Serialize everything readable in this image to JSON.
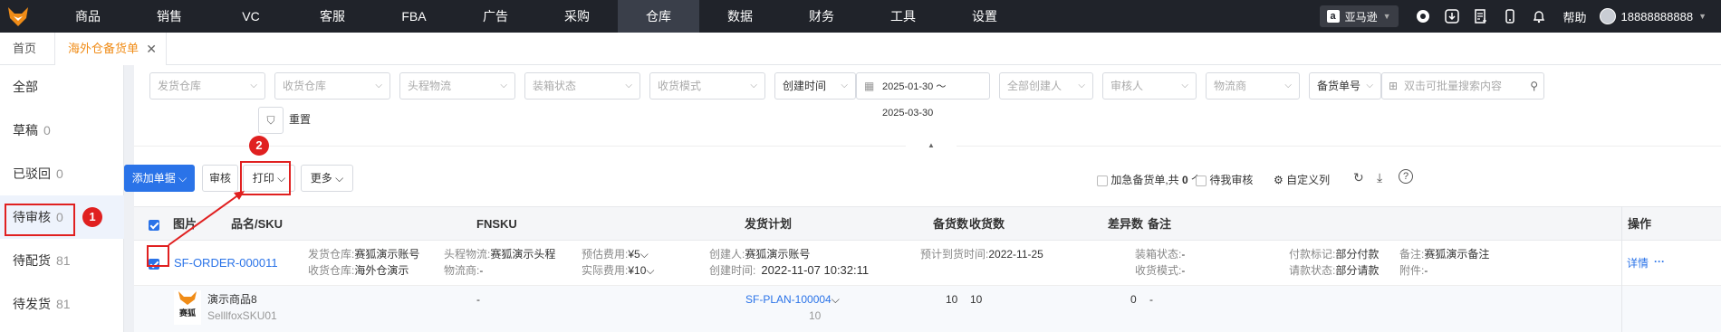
{
  "nav": {
    "items": [
      "商品",
      "销售",
      "VC",
      "客服",
      "FBA",
      "广告",
      "采购",
      "仓库",
      "数据",
      "财务",
      "工具",
      "设置"
    ],
    "active": "仓库",
    "store": "亚马逊",
    "help": "帮助",
    "user": "18888888888"
  },
  "tabs": {
    "home": "首页",
    "current": "海外仓备货单"
  },
  "sidebar": {
    "items": [
      {
        "label": "全部",
        "count": ""
      },
      {
        "label": "草稿",
        "count": "0"
      },
      {
        "label": "已驳回",
        "count": "0"
      },
      {
        "label": "待审核",
        "count": "0"
      },
      {
        "label": "待配货",
        "count": "81"
      },
      {
        "label": "待发货",
        "count": "81"
      }
    ]
  },
  "filters": {
    "ship_warehouse": "发货仓库",
    "recv_warehouse": "收货仓库",
    "first_leg": "头程物流",
    "packing_status": "装箱状态",
    "recv_mode": "收货模式",
    "time_type": "创建时间",
    "date_range": "2025-01-30 ～ 2025-03-30",
    "creator": "全部创建人",
    "reviewer": "审核人",
    "logistics": "物流商",
    "order_no_type": "备货单号",
    "search_placeholder": "双击可批量搜索内容",
    "reset": "重置"
  },
  "toolbar": {
    "add": "添加单据",
    "review": "审核",
    "print": "打印",
    "more": "更多",
    "urgent": "加急备货单,共",
    "urgent_count": "0",
    "urgent_unit": "个",
    "my_review": "待我审核",
    "custom_cols": "自定义列"
  },
  "table": {
    "headers": {
      "image": "图片",
      "name_sku": "品名/SKU",
      "fnsku": "FNSKU",
      "plan": "发货计划",
      "stock_qty": "备货数",
      "recv_qty": "收货数",
      "diff_qty": "差异数",
      "remark": "备注",
      "op": "操作"
    },
    "order": {
      "id": "SF-ORDER-000011",
      "ship_wh_label": "发货仓库:",
      "ship_wh": "赛狐演示账号",
      "recv_wh_label": "收货仓库:",
      "recv_wh": "海外仓演示",
      "first_leg_label": "头程物流:",
      "first_leg": "赛狐演示头程",
      "logistics_label": "物流商:",
      "logistics": "-",
      "est_fee_label": "预估费用:",
      "est_fee": "¥5",
      "act_fee_label": "实际费用:",
      "act_fee": "¥10",
      "creator_label": "创建人:",
      "creator": "赛狐演示账号",
      "created_label": "创建时间:",
      "created": "2022-11-07 10:32:11",
      "eta_label": "预计到货时间:",
      "eta": "2022-11-25",
      "pack_label": "装箱状态:",
      "pack": "-",
      "recv_mode_label": "收货模式:",
      "recv_mode": "-",
      "pay_label": "付款标记:",
      "pay": "部分付款",
      "req_label": "请款状态:",
      "req": "部分请款",
      "note_label": "备注:",
      "note": "赛狐演示备注",
      "attach_label": "附件:",
      "attach": "-",
      "detail": "详情",
      "more": "···"
    },
    "item": {
      "brand": "赛狐",
      "name": "演示商品8",
      "sku": "SelllfoxSKU01",
      "fnsku": "-",
      "plan": "SF-PLAN-100004",
      "plan_qty": "10",
      "stock_qty": "10",
      "recv_qty": "10",
      "diff_qty": "0",
      "remark": "-"
    }
  },
  "annotations": {
    "badge1": "1",
    "badge2": "2"
  },
  "colors": {
    "accent": "#2a73e8",
    "brand": "#f08c17",
    "annotation": "#e02020",
    "topbar": "#20232a"
  }
}
